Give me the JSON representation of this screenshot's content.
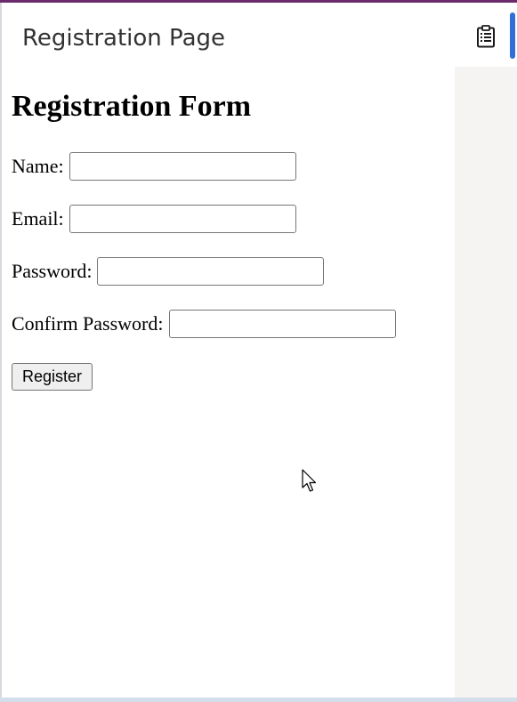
{
  "header": {
    "title": "Registration Page",
    "icon": "clipboard-icon"
  },
  "form": {
    "title": "Registration Form",
    "fields": [
      {
        "label": "Name:",
        "value": "",
        "type": "text"
      },
      {
        "label": "Email:",
        "value": "",
        "type": "email"
      },
      {
        "label": "Password:",
        "value": "",
        "type": "password"
      },
      {
        "label": "Confirm Password:",
        "value": "",
        "type": "password"
      }
    ],
    "submit_label": "Register"
  },
  "colors": {
    "top_strip": "#6b2a6b",
    "accent": "#2f6fd6",
    "right_panel": "#f5f4f3",
    "bottom_strip": "#d4deea"
  }
}
